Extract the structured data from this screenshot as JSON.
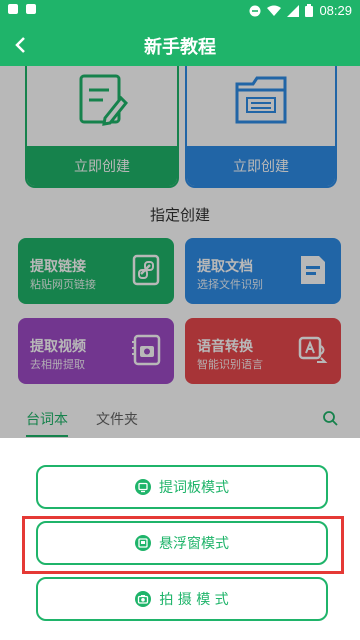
{
  "status_bar": {
    "time": "08:29"
  },
  "app_bar": {
    "title": "新手教程"
  },
  "create_cards": [
    {
      "label": "立即创建",
      "icon": "edit-document-icon"
    },
    {
      "label": "立即创建",
      "icon": "folder-icon"
    }
  ],
  "section_title": "指定创建",
  "tiles": [
    {
      "title": "提取链接",
      "subtitle": "粘贴网页链接",
      "icon": "link-icon"
    },
    {
      "title": "提取文档",
      "subtitle": "选择文件识别",
      "icon": "document-icon"
    },
    {
      "title": "提取视频",
      "subtitle": "去相册提取",
      "icon": "camera-album-icon"
    },
    {
      "title": "语音转换",
      "subtitle": "智能识别语言",
      "icon": "voice-convert-icon"
    }
  ],
  "tabs": [
    {
      "label": "台词本",
      "active": true
    },
    {
      "label": "文件夹",
      "active": false
    }
  ],
  "modes": [
    {
      "label": "提词板模式",
      "icon": "teleprompter-icon"
    },
    {
      "label": "悬浮窗模式",
      "icon": "floating-window-icon"
    },
    {
      "label": "拍 摄 模 式",
      "icon": "camera-icon"
    }
  ],
  "colors": {
    "primary": "#1fb46a",
    "blue": "#2e8ce6",
    "purple": "#9e4cc7",
    "red": "#e8484d",
    "highlight": "#e53935"
  }
}
